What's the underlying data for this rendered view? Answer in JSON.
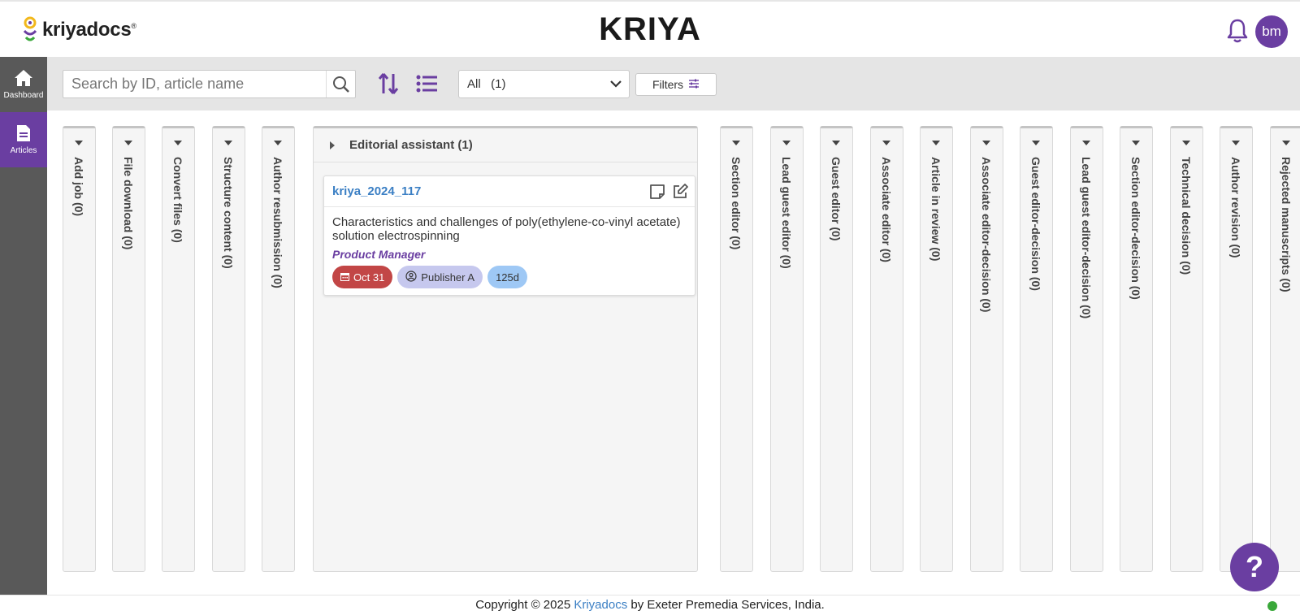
{
  "brand": {
    "logo_text": "kriyadocs",
    "logo_mark": "®",
    "app_title": "KRIYA"
  },
  "user": {
    "initials": "bm"
  },
  "sidebar": {
    "items": [
      {
        "label": "Dashboard",
        "icon": "home-icon"
      },
      {
        "label": "Articles",
        "icon": "document-icon",
        "active": true
      }
    ]
  },
  "toolbar": {
    "search_placeholder": "Search by ID, article name",
    "select_value": "All   (1)",
    "filters_label": "Filters"
  },
  "columns_left": [
    "Add job (0)",
    "File download (0)",
    "Convert files (0)",
    "Structure content (0)",
    "Author resubmission (0)"
  ],
  "open_column": {
    "label": "Editorial assistant (1)",
    "card": {
      "id": "kriya_2024_117",
      "title": "Characteristics and challenges of poly(ethylene-co-vinyl acetate) solution electrospinning",
      "role": "Product Manager",
      "date": "Oct 31",
      "publisher": "Publisher A",
      "days": "125d"
    }
  },
  "columns_right": [
    "Section editor (0)",
    "Lead guest editor (0)",
    "Guest editor (0)",
    "Associate editor (0)",
    "Article in review (0)",
    "Associate editor-decision (0)",
    "Guest editor-decision (0)",
    "Lead guest editor-decision (0)",
    "Section editor-decision (0)",
    "Technical decision (0)",
    "Author revision (0)",
    "Rejected manuscripts (0)"
  ],
  "help": {
    "label": "?"
  },
  "footer": {
    "prefix": "Copyright © 2025 ",
    "link": "Kriyadocs",
    "suffix": " by Exeter Premedia Services, India."
  },
  "colors": {
    "accent": "#6a3ea1",
    "link": "#3b7fc4",
    "date_badge": "#c24646"
  }
}
